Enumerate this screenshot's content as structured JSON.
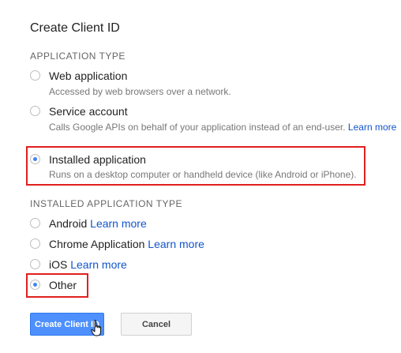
{
  "dialog": {
    "title": "Create Client ID"
  },
  "application_type": {
    "label": "APPLICATION TYPE",
    "options": [
      {
        "label": "Web application",
        "description": "Accessed by web browsers over a network.",
        "selected": false
      },
      {
        "label": "Service account",
        "description": "Calls Google APIs on behalf of your application instead of an end-user.",
        "description_link": "Learn more",
        "selected": false
      },
      {
        "label": "Installed application",
        "description": "Runs on a desktop computer or handheld device (like Android or iPhone).",
        "selected": true
      }
    ]
  },
  "installed_application_type": {
    "label": "INSTALLED APPLICATION TYPE",
    "options": [
      {
        "label": "Android",
        "link": "Learn more",
        "selected": false
      },
      {
        "label": "Chrome Application",
        "link": "Learn more",
        "selected": false
      },
      {
        "label": "iOS",
        "link": "Learn more",
        "selected": false
      },
      {
        "label": "Other",
        "selected": true
      }
    ]
  },
  "buttons": {
    "create_label": "Create Client ID",
    "cancel_label": "Cancel"
  },
  "colors": {
    "accent": "#4285f4",
    "primary_button": "#4d90fe",
    "link": "#1155cc",
    "highlight": "#e0201e"
  }
}
